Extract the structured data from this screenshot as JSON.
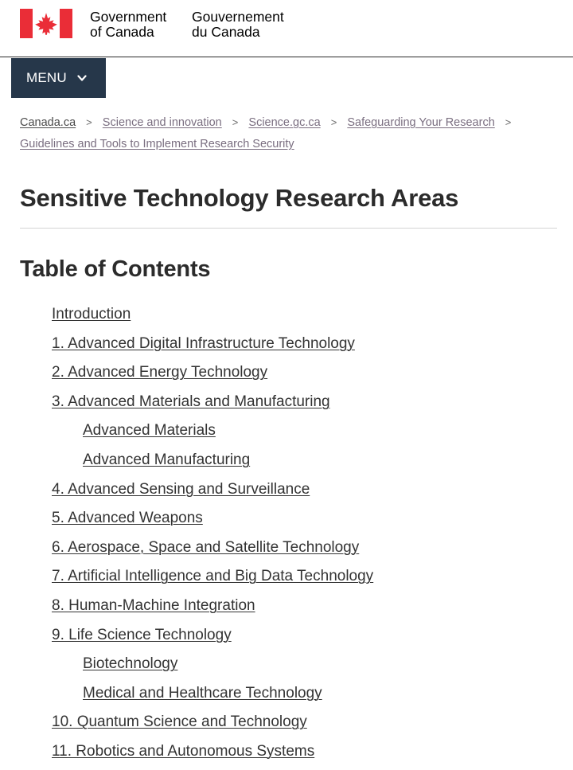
{
  "header": {
    "flag_icon": "canada-flag-icon",
    "wordmark_en_line1": "Government",
    "wordmark_en_line2": "of Canada",
    "wordmark_fr_line1": "Gouvernement",
    "wordmark_fr_line2": "du Canada",
    "menu_label": "MENU",
    "menu_caret_icon": "chevron-down-icon",
    "colors": {
      "flag_red": "#EA2D37",
      "menu_background": "#26374A",
      "link": "#7A6E80",
      "text": "#2B2B2B"
    }
  },
  "breadcrumb": {
    "separator": ">",
    "items": [
      {
        "label": "Canada.ca"
      },
      {
        "label": "Science and innovation"
      },
      {
        "label": "Science.gc.ca"
      },
      {
        "label": "Safeguarding Your Research"
      },
      {
        "label": "Guidelines and Tools to Implement Research Security"
      }
    ]
  },
  "main": {
    "page_title": "Sensitive Technology Research Areas",
    "section_title": "Table of Contents",
    "toc": [
      {
        "label": "Introduction"
      },
      {
        "label": "1. Advanced Digital Infrastructure Technology"
      },
      {
        "label": "2. Advanced Energy Technology"
      },
      {
        "label": "3. Advanced Materials and Manufacturing",
        "children": [
          {
            "label": "Advanced Materials"
          },
          {
            "label": "Advanced Manufacturing"
          }
        ]
      },
      {
        "label": "4. Advanced Sensing and Surveillance"
      },
      {
        "label": "5. Advanced Weapons"
      },
      {
        "label": "6. Aerospace, Space and Satellite Technology"
      },
      {
        "label": "7. Artificial Intelligence and Big Data Technology"
      },
      {
        "label": "8. Human-Machine Integration"
      },
      {
        "label": "9. Life Science Technology",
        "children": [
          {
            "label": "Biotechnology"
          },
          {
            "label": "Medical and Healthcare Technology"
          }
        ]
      },
      {
        "label": "10. Quantum Science and Technology"
      },
      {
        "label": "11. Robotics and Autonomous Systems"
      }
    ]
  }
}
